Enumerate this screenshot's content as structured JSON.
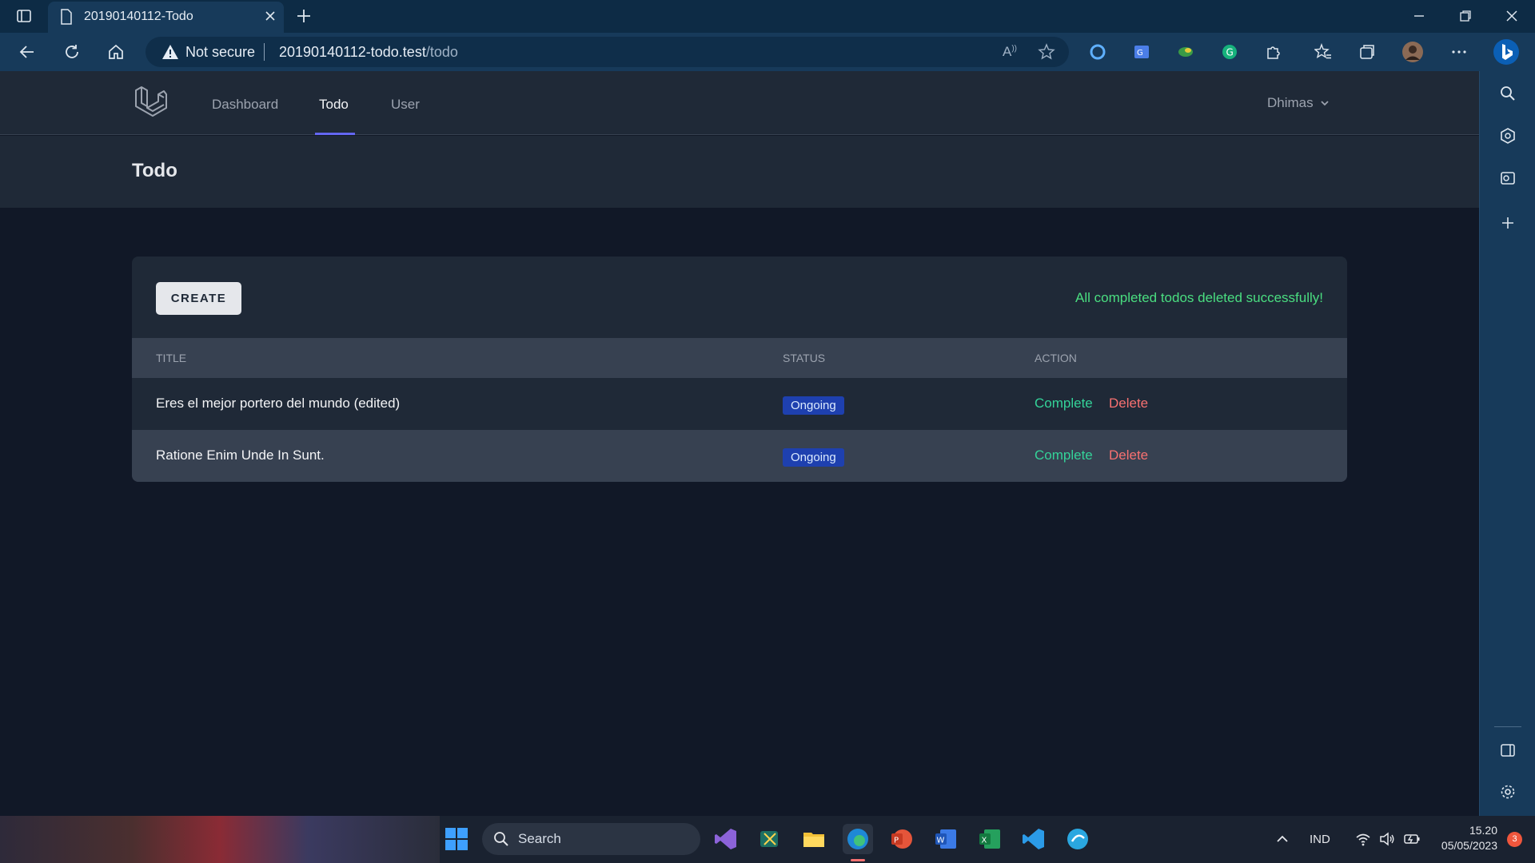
{
  "browser": {
    "tab_title": "20190140112-Todo",
    "security_label": "Not secure",
    "url_host": "20190140112-todo.test",
    "url_path": "/todo"
  },
  "nav": {
    "links": [
      "Dashboard",
      "Todo",
      "User"
    ],
    "active": "Todo",
    "user_name": "Dhimas"
  },
  "page": {
    "title": "Todo"
  },
  "card": {
    "create_label": "CREATE",
    "flash_message": "All completed todos deleted successfully!",
    "columns": [
      "TITLE",
      "STATUS",
      "ACTION"
    ],
    "rows": [
      {
        "title": "Eres el mejor portero del mundo (edited)",
        "status": "Ongoing",
        "action_complete": "Complete",
        "action_delete": "Delete"
      },
      {
        "title": "Ratione Enim Unde In Sunt.",
        "status": "Ongoing",
        "action_complete": "Complete",
        "action_delete": "Delete"
      }
    ]
  },
  "taskbar": {
    "search_label": "Search",
    "language": "IND",
    "time": "15.20",
    "date": "05/05/2023",
    "notification_count": "3"
  },
  "colors": {
    "accent": "#6366f1",
    "success": "#4ade80",
    "danger": "#f87171",
    "badge": "#1e40af"
  }
}
